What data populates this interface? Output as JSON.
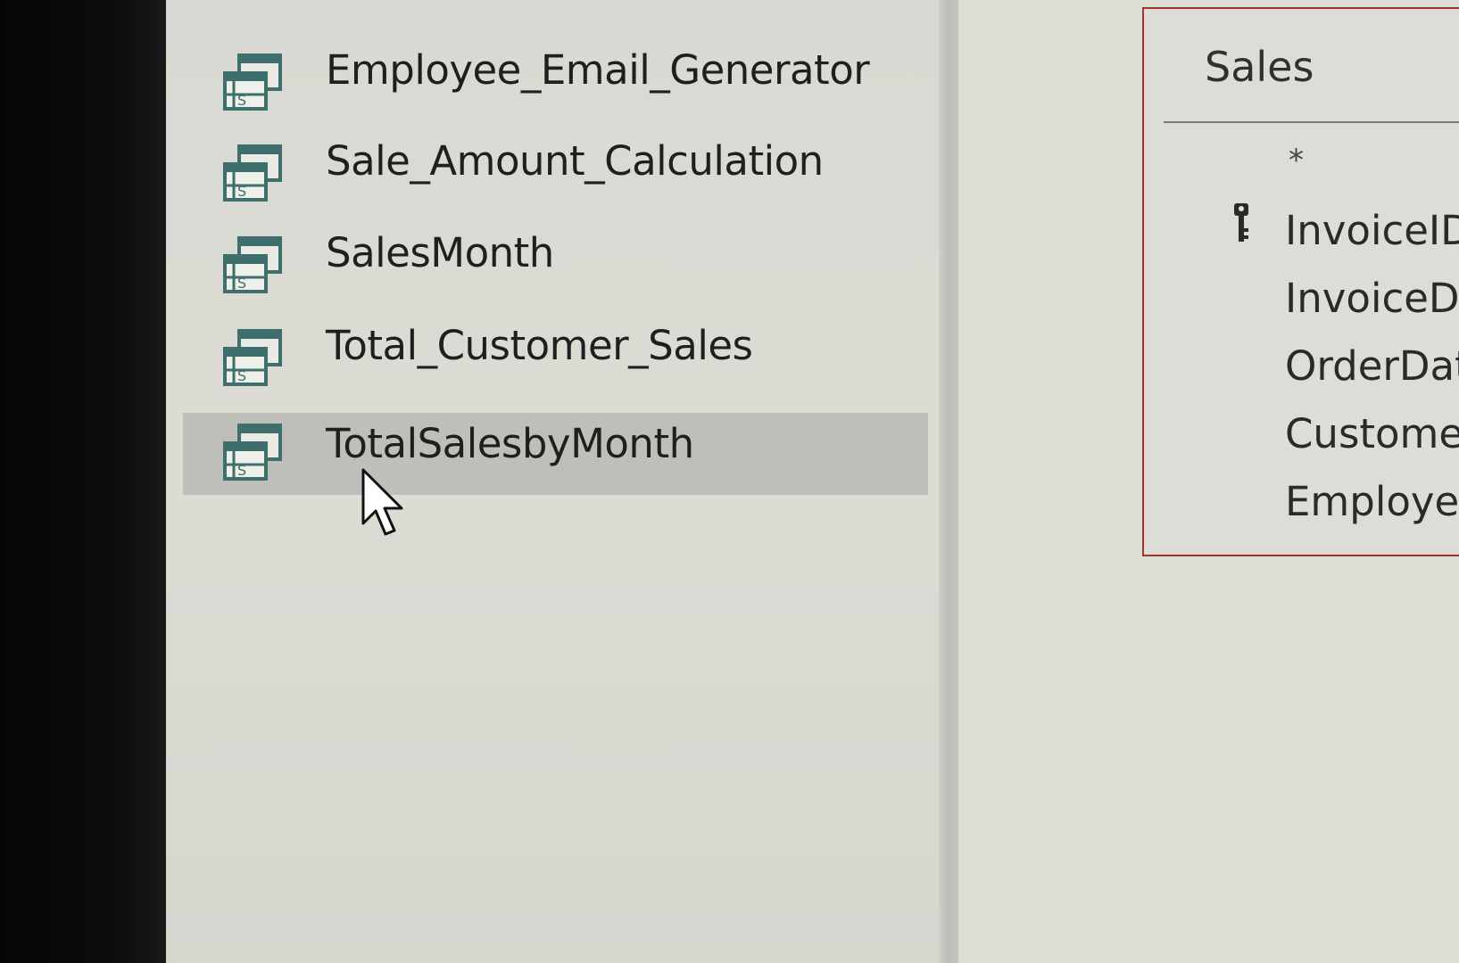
{
  "navigation": {
    "items": [
      {
        "label": "Employee_Email_Generator",
        "icon": "query-icon",
        "selected": false
      },
      {
        "label": "Sale_Amount_Calculation",
        "icon": "query-icon",
        "selected": false
      },
      {
        "label": "SalesMonth",
        "icon": "query-icon",
        "selected": false
      },
      {
        "label": "Total_Customer_Sales",
        "icon": "query-icon",
        "selected": false
      },
      {
        "label": "TotalSalesbyMonth",
        "icon": "query-icon",
        "selected": true
      }
    ]
  },
  "table": {
    "title": "Sales",
    "all_fields_marker": "*",
    "fields": [
      {
        "name": "InvoiceID",
        "primary_key": true
      },
      {
        "name": "InvoiceDa",
        "primary_key": false
      },
      {
        "name": "OrderDat",
        "primary_key": false
      },
      {
        "name": "Customer",
        "primary_key": false
      },
      {
        "name": "Employee",
        "primary_key": false
      }
    ],
    "border_color": "#a0342f"
  },
  "colors": {
    "pane_background": "#dad9d2",
    "selected_row": "#bfbfba",
    "icon_accent": "#3e6f6c"
  }
}
